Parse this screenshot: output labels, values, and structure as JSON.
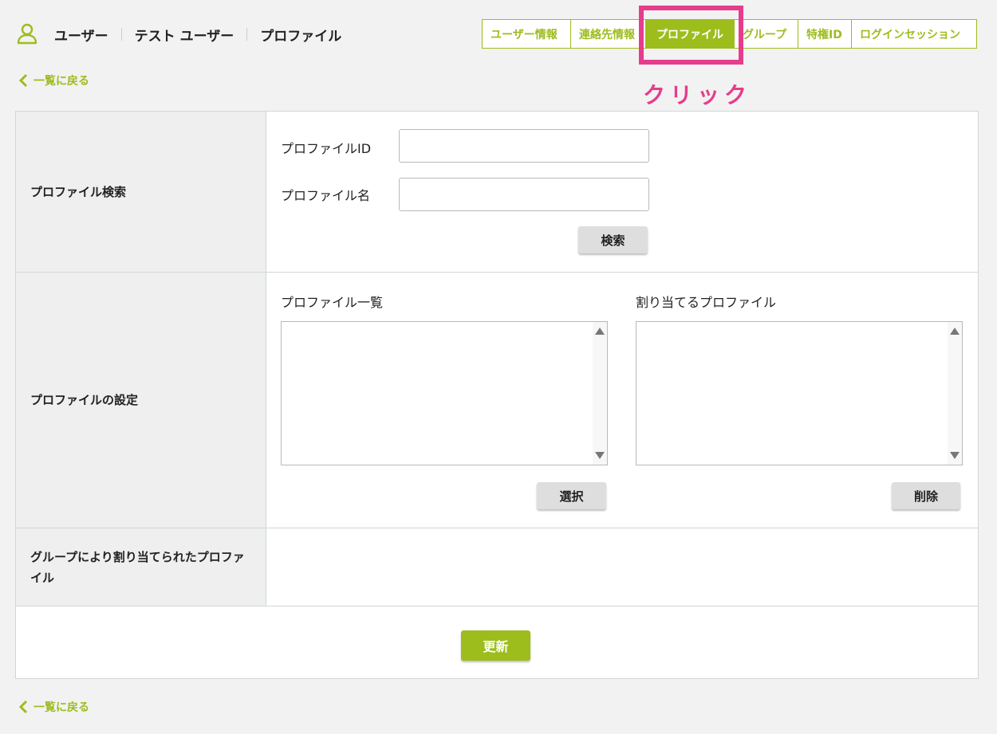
{
  "header": {
    "user_icon": "user-icon",
    "breadcrumb": [
      "ユーザー",
      "テスト ユーザー",
      "プロファイル"
    ]
  },
  "tabs": [
    {
      "label": "ユーザー情報",
      "active": false
    },
    {
      "label": "連絡先情報",
      "active": false
    },
    {
      "label": "プロファイル",
      "active": true
    },
    {
      "label": "グループ",
      "active": false
    },
    {
      "label": "特権ID",
      "active": false
    },
    {
      "label": "ログインセッション",
      "active": false
    }
  ],
  "annotation": {
    "text": "クリック",
    "color": "#e63c8c"
  },
  "back_link": {
    "label": "一覧に戻る"
  },
  "search_section": {
    "label": "プロファイル検索",
    "profile_id_label": "プロファイルID",
    "profile_id_value": "",
    "profile_name_label": "プロファイル名",
    "profile_name_value": "",
    "search_button": "検索"
  },
  "settings_section": {
    "label": "プロファイルの設定",
    "available_label": "プロファイル一覧",
    "assigned_label": "割り当てるプロファイル",
    "available_items": [],
    "assigned_items": [],
    "select_button": "選択",
    "delete_button": "削除"
  },
  "group_section": {
    "label": "グループにより割り当てられたプロファイル"
  },
  "update_button": "更新",
  "colors": {
    "accent": "#9dbd1d",
    "highlight": "#e63c8c"
  }
}
